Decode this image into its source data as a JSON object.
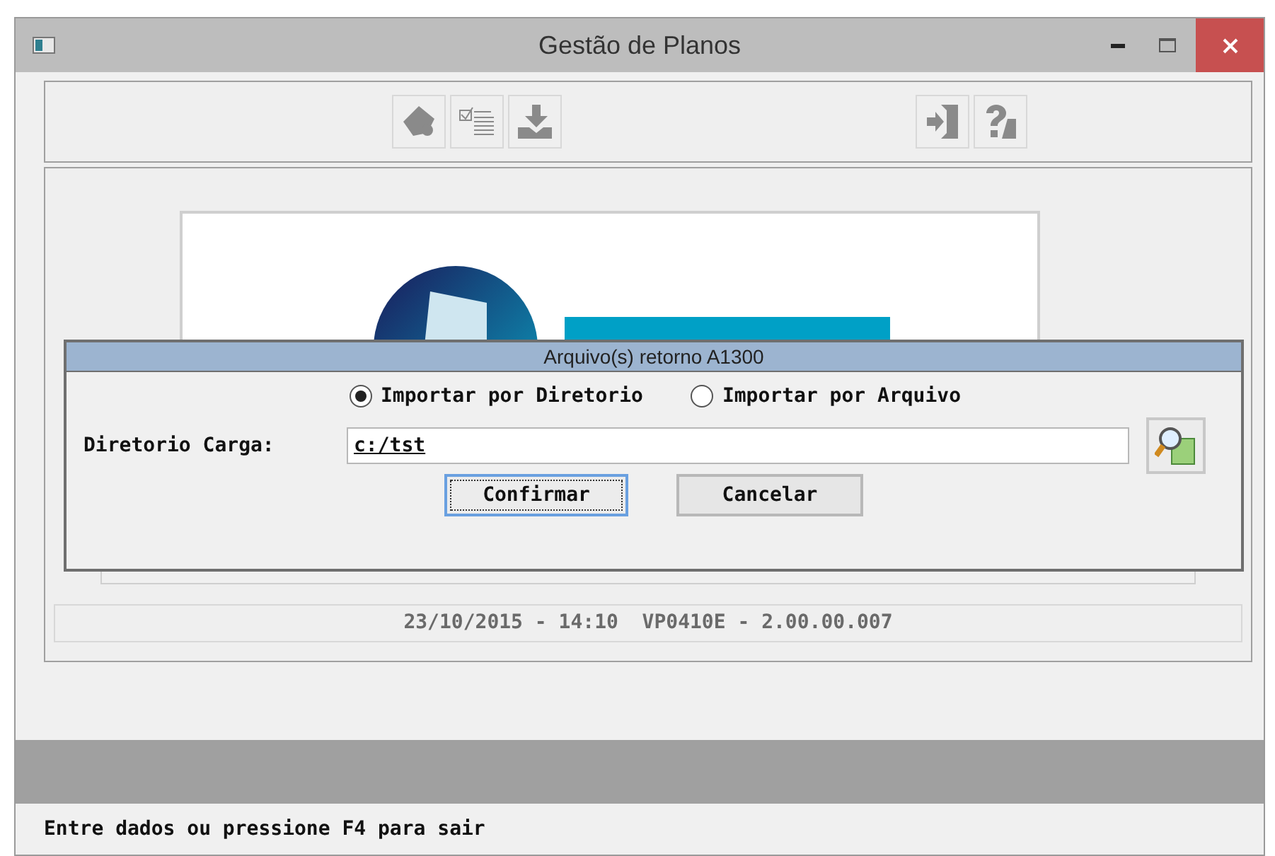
{
  "window": {
    "title": "Gestão de Planos"
  },
  "dialog": {
    "title": "Arquivo(s) retorno A1300",
    "options": [
      {
        "label": "Importar por Diretorio",
        "selected": true
      },
      {
        "label": "Importar por Arquivo",
        "selected": false
      }
    ],
    "field": {
      "label": "Diretorio Carga:",
      "value": "c:/tst"
    },
    "buttons": [
      {
        "label": "Confirmar",
        "focused": true
      },
      {
        "label": "Cancelar",
        "focused": false
      }
    ]
  },
  "info_line": "23/10/2015 - 14:10  VP0410E - 2.00.00.007",
  "status_bar": "Entre dados ou pressione F4 para sair"
}
